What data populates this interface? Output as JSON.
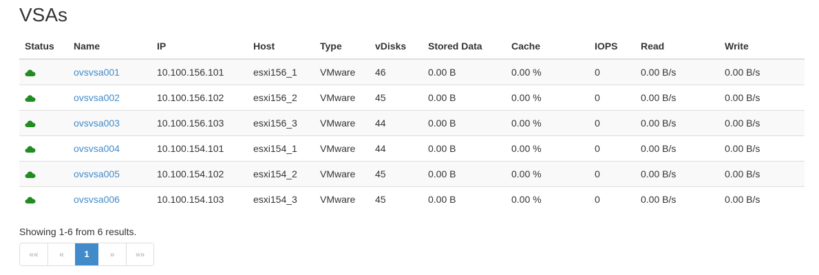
{
  "page": {
    "title": "VSAs"
  },
  "table": {
    "columns": [
      "Status",
      "Name",
      "IP",
      "Host",
      "Type",
      "vDisks",
      "Stored Data",
      "Cache",
      "IOPS",
      "Read",
      "Write"
    ],
    "rows": [
      {
        "status_icon": "cloud-icon",
        "status_color": "#228b22",
        "name": "ovsvsa001",
        "ip": "10.100.156.101",
        "host": "esxi156_1",
        "type": "VMware",
        "vdisks": "46",
        "stored_data": "0.00 B",
        "cache": "0.00 %",
        "iops": "0",
        "read": "0.00 B/s",
        "write": "0.00 B/s"
      },
      {
        "status_icon": "cloud-icon",
        "status_color": "#228b22",
        "name": "ovsvsa002",
        "ip": "10.100.156.102",
        "host": "esxi156_2",
        "type": "VMware",
        "vdisks": "45",
        "stored_data": "0.00 B",
        "cache": "0.00 %",
        "iops": "0",
        "read": "0.00 B/s",
        "write": "0.00 B/s"
      },
      {
        "status_icon": "cloud-icon",
        "status_color": "#228b22",
        "name": "ovsvsa003",
        "ip": "10.100.156.103",
        "host": "esxi156_3",
        "type": "VMware",
        "vdisks": "44",
        "stored_data": "0.00 B",
        "cache": "0.00 %",
        "iops": "0",
        "read": "0.00 B/s",
        "write": "0.00 B/s"
      },
      {
        "status_icon": "cloud-icon",
        "status_color": "#228b22",
        "name": "ovsvsa004",
        "ip": "10.100.154.101",
        "host": "esxi154_1",
        "type": "VMware",
        "vdisks": "44",
        "stored_data": "0.00 B",
        "cache": "0.00 %",
        "iops": "0",
        "read": "0.00 B/s",
        "write": "0.00 B/s"
      },
      {
        "status_icon": "cloud-icon",
        "status_color": "#228b22",
        "name": "ovsvsa005",
        "ip": "10.100.154.102",
        "host": "esxi154_2",
        "type": "VMware",
        "vdisks": "45",
        "stored_data": "0.00 B",
        "cache": "0.00 %",
        "iops": "0",
        "read": "0.00 B/s",
        "write": "0.00 B/s"
      },
      {
        "status_icon": "cloud-icon",
        "status_color": "#228b22",
        "name": "ovsvsa006",
        "ip": "10.100.154.103",
        "host": "esxi154_3",
        "type": "VMware",
        "vdisks": "45",
        "stored_data": "0.00 B",
        "cache": "0.00 %",
        "iops": "0",
        "read": "0.00 B/s",
        "write": "0.00 B/s"
      }
    ]
  },
  "summary": {
    "text": "Showing 1-6 from 6 results."
  },
  "pagination": {
    "first": "««",
    "prev": "«",
    "current": "1",
    "next": "»",
    "last": "»»",
    "active_color": "#428bca"
  },
  "colors": {
    "link": "#428bca",
    "status_ok": "#228b22",
    "stripe": "#f9f9f9"
  }
}
